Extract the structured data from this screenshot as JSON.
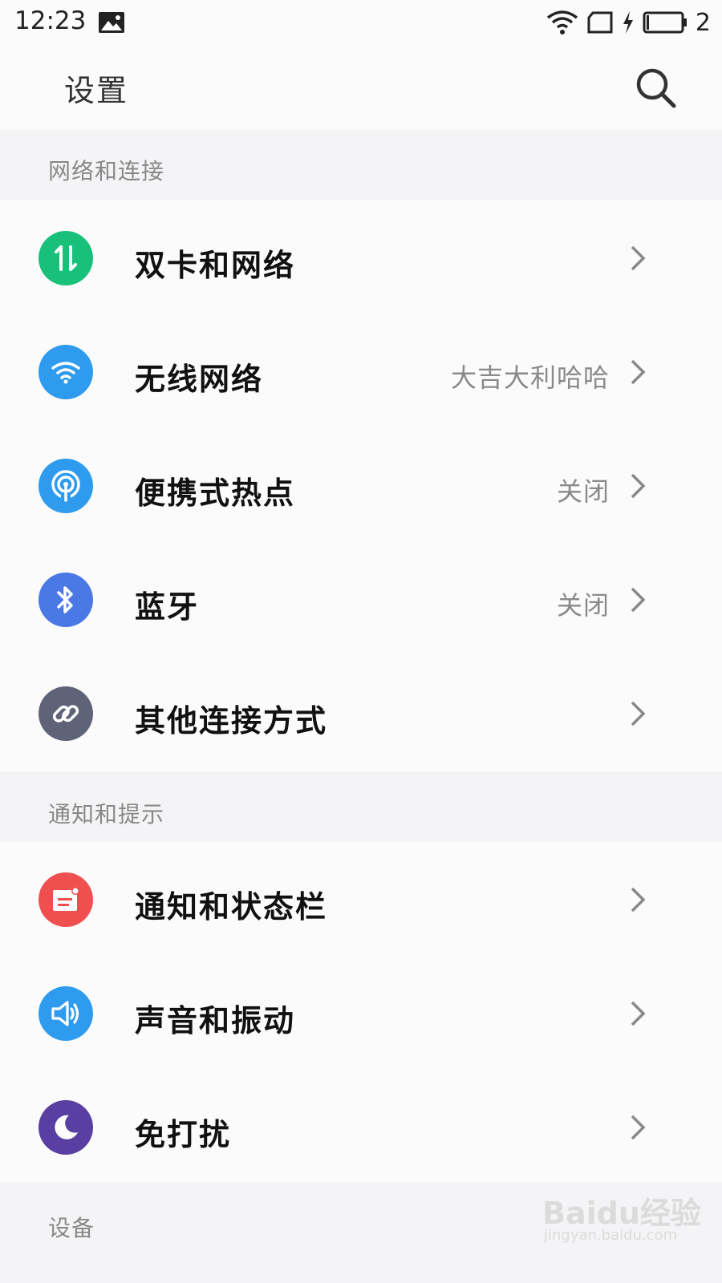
{
  "status_bar": {
    "time": "12:23",
    "battery_count": "2",
    "icons": [
      "photo-notification-icon",
      "wifi-icon",
      "sim-icon",
      "charging-icon",
      "battery-icon"
    ]
  },
  "header": {
    "title": "设置",
    "search_icon": "search-icon"
  },
  "sections": [
    {
      "label": "网络和连接",
      "items": [
        {
          "label": "双卡和网络",
          "value": "",
          "icon": "dual-sim-icon",
          "color": "#19c07a"
        },
        {
          "label": "无线网络",
          "value": "大吉大利哈哈",
          "icon": "wifi-icon",
          "color": "#2e9bef"
        },
        {
          "label": "便携式热点",
          "value": "关闭",
          "icon": "hotspot-icon",
          "color": "#2e9bef"
        },
        {
          "label": "蓝牙",
          "value": "关闭",
          "icon": "bluetooth-icon",
          "color": "#4a79e6"
        },
        {
          "label": "其他连接方式",
          "value": "",
          "icon": "link-icon",
          "color": "#5e6377"
        }
      ]
    },
    {
      "label": "通知和提示",
      "items": [
        {
          "label": "通知和状态栏",
          "value": "",
          "icon": "notification-icon",
          "color": "#ef4f4f"
        },
        {
          "label": "声音和振动",
          "value": "",
          "icon": "sound-icon",
          "color": "#2e9bef"
        },
        {
          "label": "免打扰",
          "value": "",
          "icon": "moon-icon",
          "color": "#5a3fa3"
        }
      ]
    },
    {
      "label": "设备",
      "items": []
    }
  ],
  "watermark": {
    "text": "Baidu经验",
    "sub": "jingyan.baidu.com"
  }
}
